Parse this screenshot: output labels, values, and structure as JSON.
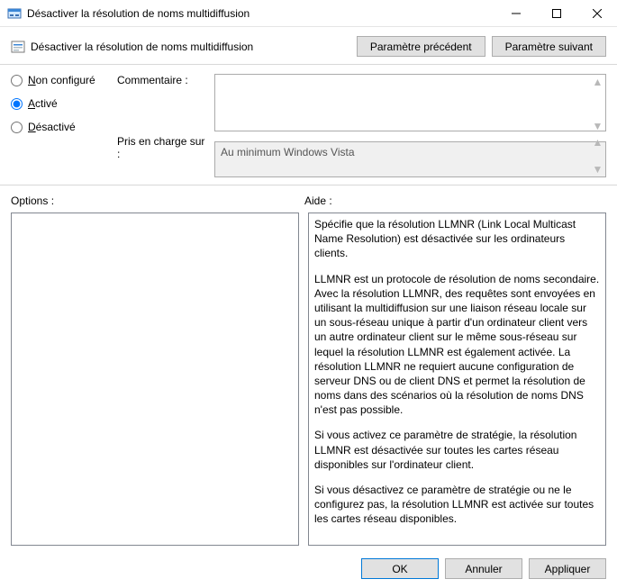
{
  "window": {
    "title": "Désactiver la résolution de noms multidiffusion"
  },
  "header": {
    "setting_title": "Désactiver la résolution de noms multidiffusion",
    "prev_btn": "Paramètre précédent",
    "next_btn": "Paramètre suivant"
  },
  "state": {
    "options": [
      {
        "key": "not_configured",
        "label_pre": "",
        "label_u": "N",
        "label_post": "on configuré",
        "checked": false
      },
      {
        "key": "enabled",
        "label_pre": "",
        "label_u": "A",
        "label_post": "ctivé",
        "checked": true
      },
      {
        "key": "disabled",
        "label_pre": "",
        "label_u": "D",
        "label_post": "ésactivé",
        "checked": false
      }
    ],
    "comment_label": "Commentaire :",
    "comment_value": "",
    "supported_label": "Pris en charge sur :",
    "supported_value": "Au minimum Windows Vista"
  },
  "lower": {
    "options_label": "Options :",
    "help_label": "Aide :"
  },
  "help": {
    "p1": "Spécifie que la résolution LLMNR (Link Local Multicast Name Resolution) est désactivée sur les ordinateurs clients.",
    "p2": "LLMNR est un protocole de résolution de noms secondaire. Avec la résolution LLMNR, des requêtes sont envoyées en utilisant la multidiffusion sur une liaison réseau locale sur un sous-réseau unique à partir d'un ordinateur client vers un autre ordinateur client sur le même sous-réseau sur lequel la résolution LLMNR est également activée. La résolution LLMNR ne requiert aucune configuration de serveur DNS ou de client DNS et permet la résolution de noms dans des scénarios où la résolution de noms DNS n'est pas possible.",
    "p3": "Si vous activez ce paramètre de stratégie, la résolution LLMNR est désactivée sur toutes les cartes réseau disponibles sur l'ordinateur client.",
    "p4": "Si vous désactivez ce paramètre de stratégie ou ne le configurez pas, la résolution LLMNR est activée sur toutes les cartes réseau disponibles."
  },
  "footer": {
    "ok": "OK",
    "cancel": "Annuler",
    "apply": "Appliquer"
  }
}
